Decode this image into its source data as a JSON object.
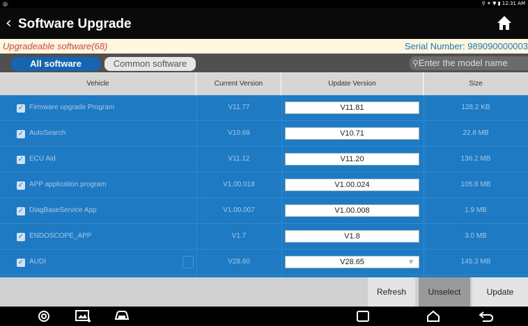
{
  "status": {
    "left_icon": "notification-icon",
    "right_text": "⚲ ✶ ▼ ▮ 12:31 AM"
  },
  "header": {
    "title": "Software Upgrade",
    "back_icon": "back-arrow-icon",
    "home_icon": "home-icon"
  },
  "info": {
    "upgradeable": "Upgradeable software(68)",
    "serial": "Serial Number: 989090000003"
  },
  "tabs": {
    "all": "All software",
    "common": "Common software"
  },
  "search": {
    "placeholder": "Enter the model name"
  },
  "table": {
    "headers": {
      "vehicle": "Vehicle",
      "current": "Current Version",
      "update": "Update Version",
      "size": "Size"
    },
    "rows": [
      {
        "vehicle": "Firmware upgrade Program",
        "current": "V11.77",
        "update": "V11.81",
        "size": "128.2 KB"
      },
      {
        "vehicle": "AutoSearch",
        "current": "V10.69",
        "update": "V10.71",
        "size": "22.8 MB"
      },
      {
        "vehicle": "ECU Aid",
        "current": "V11.12",
        "update": "V11.20",
        "size": "136.2 MB"
      },
      {
        "vehicle": "APP application program",
        "current": "V1.00.018",
        "update": "V1.00.024",
        "size": "105.8 MB"
      },
      {
        "vehicle": "DiagBaseService App",
        "current": "V1.00.007",
        "update": "V1.00.008",
        "size": "1.9 MB"
      },
      {
        "vehicle": "ENDOSCOPE_APP",
        "current": "V1.7",
        "update": "V1.8",
        "size": "3.0 MB"
      },
      {
        "vehicle": "AUDI",
        "current": "V28.60",
        "update": "V28.65",
        "size": "145.3 MB"
      }
    ]
  },
  "buttons": {
    "refresh": "Refresh",
    "unselect": "Unselect",
    "update": "Update"
  },
  "colors": {
    "header_bg": "#0a0a0a",
    "row_bg": "#1e7ac2",
    "accent": "#1565b5",
    "warning_text": "#e5443a"
  }
}
